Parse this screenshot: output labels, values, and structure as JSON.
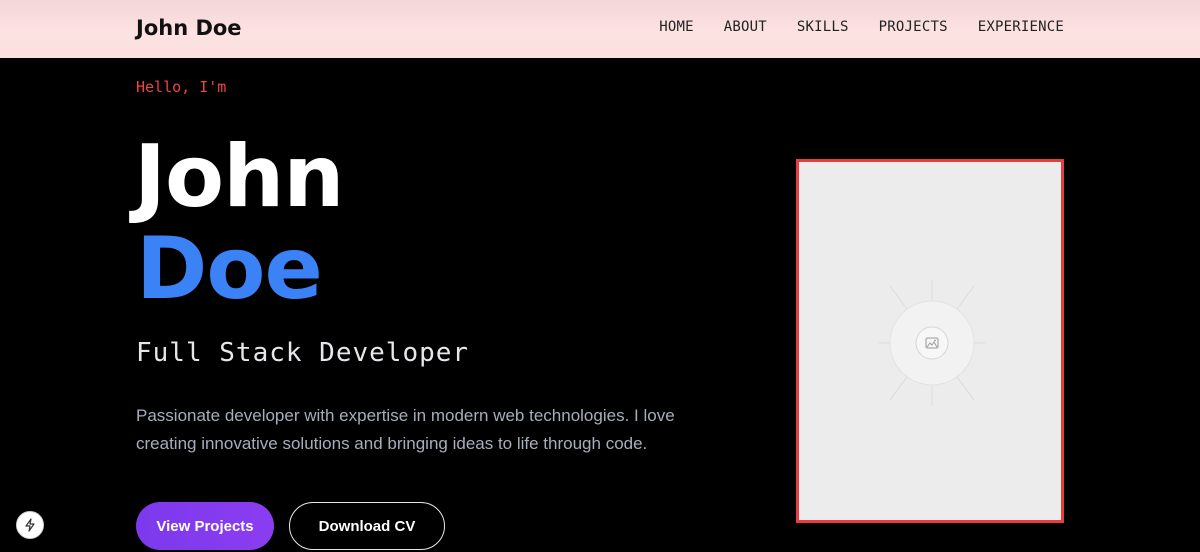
{
  "header": {
    "brand": "John Doe",
    "nav": [
      "HOME",
      "ABOUT",
      "SKILLS",
      "PROJECTS",
      "EXPERIENCE"
    ]
  },
  "hero": {
    "greeting": "Hello, I'm",
    "first_name": "John",
    "last_name": "Doe",
    "role": "Full Stack Developer",
    "description": "Passionate developer with expertise in modern web technologies. I love creating innovative solutions and bringing ideas to life through code.",
    "primary_button": "View Projects",
    "secondary_button": "Download CV"
  },
  "icons": {
    "corner": "eye-slash-icon",
    "image_placeholder": "image-icon",
    "fab": "bolt-icon"
  },
  "colors": {
    "accent_red": "#ef4444",
    "accent_blue": "#3b82f6",
    "accent_purple": "#7c3aed",
    "frame_border": "#e53e3e"
  }
}
